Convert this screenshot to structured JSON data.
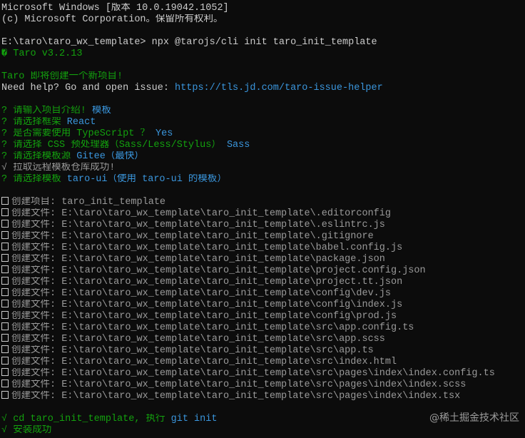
{
  "terminal": {
    "header": {
      "version": "Microsoft Windows [版本 10.0.19042.1052]",
      "copyright": "(c) Microsoft Corporation。保留所有权利。"
    },
    "command": {
      "prompt": "E:\\taro\\taro_wx_template>",
      "text": " npx @tarojs/cli init taro_init_template"
    },
    "taro_version": {
      "icon": "�",
      "text": " Taro v3.2.13"
    },
    "intro": {
      "line1": "Taro 即将创建一个新项目!",
      "line2_prefix": "Need help? Go and open issue: ",
      "line2_link": "https://tls.jd.com/taro-issue-helper"
    },
    "questions": [
      {
        "q": "? 请输入项目介绍!",
        "a": " 模板"
      },
      {
        "q": "? 请选择框架",
        "a": " React"
      },
      {
        "q": "? 是否需要使用 TypeScript ？",
        "a": " Yes"
      },
      {
        "q": "? 请选择 CSS 预处理器（Sass/Less/Stylus）",
        "a": " Sass"
      },
      {
        "q": "? 请选择模板源",
        "a": " Gitee（最快）"
      }
    ],
    "fetch_success": "√ 拉取远程模板仓库成功!",
    "template_question": {
      "q": "? 请选择模板",
      "a": " taro-ui（使用 taro-ui 的模板）"
    },
    "created_items": [
      {
        "label": "创建项目:",
        "path": " taro_init_template"
      },
      {
        "label": "创建文件:",
        "path": " E:\\taro\\taro_wx_template\\taro_init_template\\.editorconfig"
      },
      {
        "label": "创建文件:",
        "path": " E:\\taro\\taro_wx_template\\taro_init_template\\.eslintrc.js"
      },
      {
        "label": "创建文件:",
        "path": " E:\\taro\\taro_wx_template\\taro_init_template\\.gitignore"
      },
      {
        "label": "创建文件:",
        "path": " E:\\taro\\taro_wx_template\\taro_init_template\\babel.config.js"
      },
      {
        "label": "创建文件:",
        "path": " E:\\taro\\taro_wx_template\\taro_init_template\\package.json"
      },
      {
        "label": "创建文件:",
        "path": " E:\\taro\\taro_wx_template\\taro_init_template\\project.config.json"
      },
      {
        "label": "创建文件:",
        "path": " E:\\taro\\taro_wx_template\\taro_init_template\\project.tt.json"
      },
      {
        "label": "创建文件:",
        "path": " E:\\taro\\taro_wx_template\\taro_init_template\\config\\dev.js"
      },
      {
        "label": "创建文件:",
        "path": " E:\\taro\\taro_wx_template\\taro_init_template\\config\\index.js"
      },
      {
        "label": "创建文件:",
        "path": " E:\\taro\\taro_wx_template\\taro_init_template\\config\\prod.js"
      },
      {
        "label": "创建文件:",
        "path": " E:\\taro\\taro_wx_template\\taro_init_template\\src\\app.config.ts"
      },
      {
        "label": "创建文件:",
        "path": " E:\\taro\\taro_wx_template\\taro_init_template\\src\\app.scss"
      },
      {
        "label": "创建文件:",
        "path": " E:\\taro\\taro_wx_template\\taro_init_template\\src\\app.ts"
      },
      {
        "label": "创建文件:",
        "path": " E:\\taro\\taro_wx_template\\taro_init_template\\src\\index.html"
      },
      {
        "label": "创建文件:",
        "path": " E:\\taro\\taro_wx_template\\taro_init_template\\src\\pages\\index\\index.config.ts"
      },
      {
        "label": "创建文件:",
        "path": " E:\\taro\\taro_wx_template\\taro_init_template\\src\\pages\\index\\index.scss"
      },
      {
        "label": "创建文件:",
        "path": " E:\\taro\\taro_wx_template\\taro_init_template\\src\\pages\\index\\index.tsx"
      }
    ],
    "git_init": {
      "prefix": "√ cd taro_init_template, 执行",
      "cmd": " git init"
    },
    "install_success": "√ 安装成功"
  },
  "watermark": "@稀土掘金技术社区",
  "colors": {
    "background": "#0c0c0c",
    "text": "#cccccc",
    "green": "#13a10e",
    "cyan": "#3a96dd",
    "gray": "#9a9a9a"
  }
}
